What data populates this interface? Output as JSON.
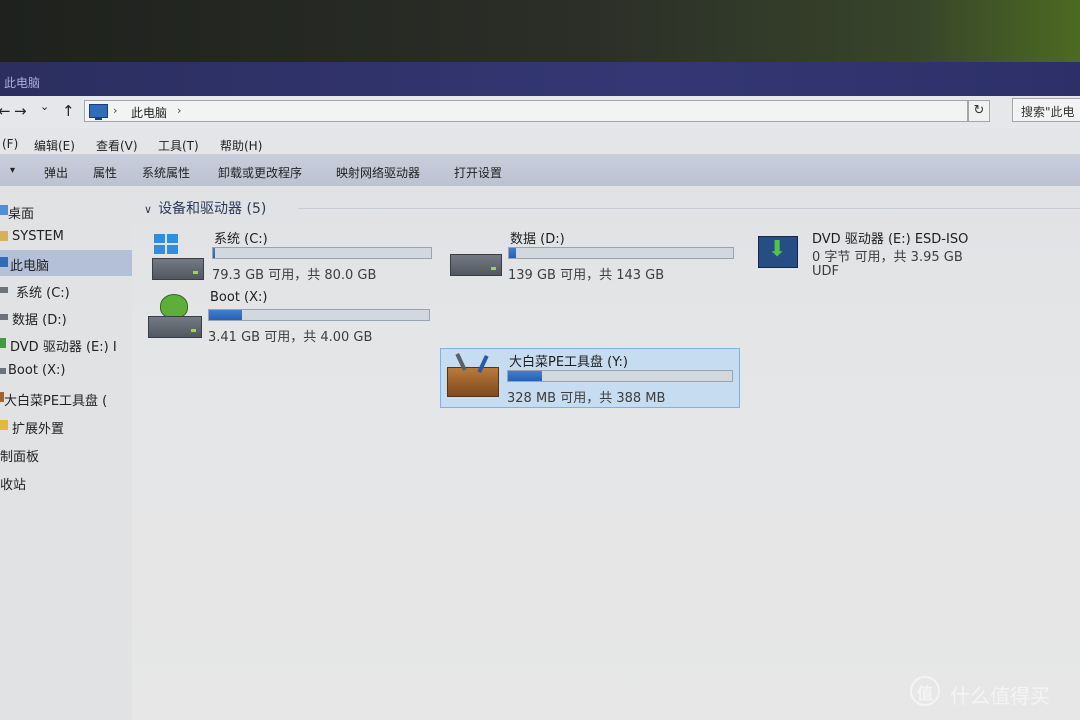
{
  "window": {
    "title": "此电脑"
  },
  "address_bar": {
    "back_glyph": "←",
    "forward_glyph": "→",
    "recent_glyph": "⌄",
    "up_glyph": "↑",
    "path": [
      "此电脑"
    ],
    "separator": "›",
    "dropdown_glyph": "⌄",
    "refresh_glyph": "↻",
    "search_placeholder": "搜索\"此电"
  },
  "menu": [
    "(F)",
    "编辑(E)",
    "查看(V)",
    "工具(T)",
    "帮助(H)"
  ],
  "toolbar": {
    "dropdown_glyph": "▾",
    "items": [
      "弹出",
      "属性",
      "系统属性",
      "卸载或更改程序",
      "映射网络驱动器",
      "打开设置"
    ]
  },
  "sidebar": {
    "items": [
      {
        "label": "桌面",
        "icon": "desktop-icon"
      },
      {
        "label": "SYSTEM",
        "icon": "user-folder-icon"
      },
      {
        "label": "此电脑",
        "icon": "computer-icon",
        "selected": true
      },
      {
        "label": "系统 (C:)",
        "icon": "drive-icon"
      },
      {
        "label": "数据 (D:)",
        "icon": "drive-icon"
      },
      {
        "label": "DVD 驱动器 (E:) I",
        "icon": "dvd-icon"
      },
      {
        "label": "Boot (X:)",
        "icon": "drive-icon"
      },
      {
        "label": "大白菜PE工具盘 (",
        "icon": "toolbox-icon"
      },
      {
        "label": "扩展外置",
        "icon": "folder-icon"
      },
      {
        "label": "控制面板",
        "icon": "control-panel-icon"
      },
      {
        "label": "收站",
        "icon": "recycle-bin-icon"
      }
    ]
  },
  "devices_group": {
    "collapse_glyph": "∨",
    "title": "设备和驱动器 (5)",
    "drives": [
      {
        "name": "系统 (C:)",
        "free_text": "79.3 GB 可用，共 80.0 GB",
        "used_fraction": 0.01,
        "icon": "windows-drive-icon"
      },
      {
        "name": "数据 (D:)",
        "free_text": "139 GB 可用，共 143 GB",
        "used_fraction": 0.03,
        "icon": "hard-drive-icon"
      },
      {
        "name": "DVD 驱动器 (E:) ESD-ISO",
        "line2": "0 字节 可用，共 3.95 GB",
        "line3": "UDF",
        "icon": "dvd-drive-icon"
      },
      {
        "name": "Boot (X:)",
        "free_text": "3.41 GB 可用，共 4.00 GB",
        "used_fraction": 0.15,
        "icon": "boot-drive-icon"
      },
      {
        "name": "大白菜PE工具盘 (Y:)",
        "free_text": "328 MB 可用，共 388 MB",
        "used_fraction": 0.15,
        "icon": "toolbox-drive-icon",
        "selected": true
      }
    ]
  },
  "watermark": {
    "logo_glyph": "值",
    "text": "什么值得买"
  },
  "colors": {
    "title_bar": "#343773",
    "selection": "#c6dcf1",
    "bar_fill": "#2a5fb0"
  }
}
